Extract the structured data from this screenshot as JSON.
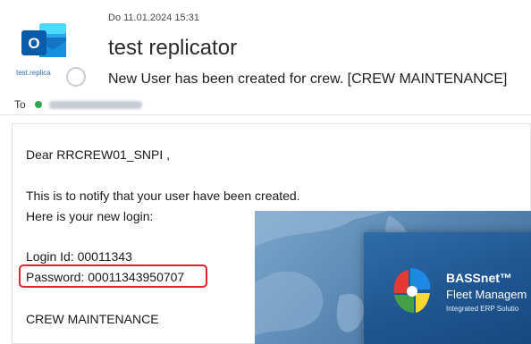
{
  "email": {
    "date": "Do 11.01.2024 15:31",
    "sender": "test replicator",
    "subject": "New User has been created for crew. [CREW MAINTENANCE]",
    "to_label": "To",
    "avatar_label": "test.replica"
  },
  "body": {
    "greeting": "Dear RRCREW01_SNPI ,",
    "notify": "This is to notify that your user have been created.",
    "login_intro": "Here is your new login:",
    "login_id": "Login Id: 00011343",
    "password": "Password: 00011343950707",
    "department": "CREW MAINTENANCE"
  },
  "banner": {
    "title": "BASSnet™",
    "subtitle": "Fleet Managem",
    "tagline": "Integrated ERP Solutio"
  },
  "colors": {
    "highlight": "#e0232d",
    "outlook_blue": "#0f6cbd",
    "status_green": "#2fa84f"
  }
}
